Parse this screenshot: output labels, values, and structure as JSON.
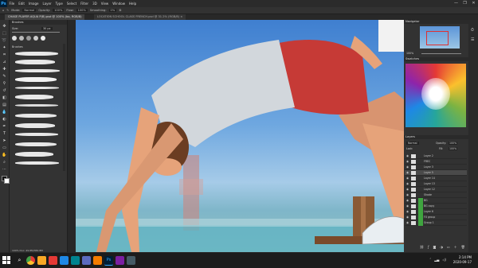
{
  "app": {
    "logo": "Ps"
  },
  "menu": [
    "File",
    "Edit",
    "Image",
    "Layer",
    "Type",
    "Select",
    "Filter",
    "3D",
    "View",
    "Window",
    "Help"
  ],
  "window_controls": [
    "—",
    "❐",
    "✕"
  ],
  "options_bar": {
    "mode_label": "Mode:",
    "mode_value": "Normal",
    "opacity_label": "Opacity:",
    "opacity_value": "100%",
    "flow_label": "Flow:",
    "flow_value": "100%",
    "smoothing_label": "Smoothing:",
    "smoothing_value": "0%"
  },
  "document": {
    "tab_title": "CHASE PLAYER AQUA P(B).psd @ 100% (bo, RGB/8)",
    "tab2_title": "LOCATION SCHOOL CLASS FRENCH.psd @ 31.2% (RGB/8) ×"
  },
  "brush_panel": {
    "title": "Brushes",
    "size_label": "Size:",
    "size_value": "30 px",
    "folder_label": "Brushes"
  },
  "status": {
    "zoom": "100%",
    "doc_size": "Doc: 49.8M/384.8M"
  },
  "panels": {
    "navigator_title": "Navigator",
    "navigator_zoom": "100%",
    "swatches_title": "Swatches",
    "layers_title": "Layers",
    "blend_mode": "Normal",
    "opacity_label": "Opacity:",
    "opacity_value": "100%",
    "lock_label": "Lock:",
    "fill_label": "Fill:",
    "fill_value": "100%"
  },
  "layers": [
    "Layer 2",
    "FREC",
    "Layer 3",
    "Layer 5",
    "Layer 14",
    "Layer 13",
    "Layer 12",
    "Shade",
    "BG",
    "BG copy",
    "Layer 6",
    "FX group",
    "Group 1"
  ],
  "taskbar": {
    "time": "2:14 PM",
    "date": "2020-09-17"
  },
  "colors": {
    "sky_top": "#3f7fd0",
    "shirt": "#d2d7dc",
    "shorts": "#c63a36",
    "skin": "#e6a37a",
    "hair": "#6b3d22",
    "layer_group": "#3fa43f"
  }
}
